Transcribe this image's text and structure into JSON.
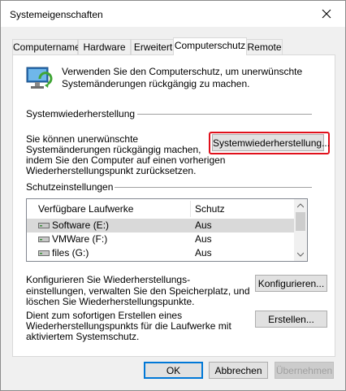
{
  "window": {
    "title": "Systemeigenschaften"
  },
  "tabs": [
    {
      "label": "Computername"
    },
    {
      "label": "Hardware"
    },
    {
      "label": "Erweitert"
    },
    {
      "label": "Computerschutz"
    },
    {
      "label": "Remote"
    }
  ],
  "intro": {
    "line1": "Verwenden Sie den Computerschutz, um unerwünschte",
    "line2": "Systemänderungen rückgängig zu machen."
  },
  "restore": {
    "heading": "Systemwiederherstellung",
    "line1": "Sie können unerwünschte",
    "line2": "Systemänderungen rückgängig machen,",
    "line3": "indem Sie den Computer auf einen vorherigen",
    "line4": "Wiederherstellungspunkt zurücksetzen.",
    "button": "Systemwiederherstellung..."
  },
  "protection": {
    "heading": "Schutzeinstellungen",
    "columns": {
      "drives": "Verfügbare Laufwerke",
      "protection": "Schutz"
    },
    "rows": [
      {
        "drive": "Software (E:)",
        "status": "Aus",
        "icon": "drive-icon"
      },
      {
        "drive": "VMWare (F:)",
        "status": "Aus",
        "icon": "drive-icon"
      },
      {
        "drive": "files (G:)",
        "status": "Aus",
        "icon": "drive-icon"
      }
    ],
    "configure": {
      "line1": "Konfigurieren Sie Wiederherstellungs-",
      "line2": "einstellungen, verwalten Sie den Speicherplatz, und",
      "line3": "löschen Sie Wiederherstellungspunkte.",
      "button": "Konfigurieren..."
    },
    "create": {
      "line1": "Dient zum sofortigen Erstellen eines",
      "line2": "Wiederherstellungspunkts für die Laufwerke mit",
      "line3": "aktiviertem Systemschutz.",
      "button": "Erstellen..."
    }
  },
  "footer": {
    "ok": "OK",
    "cancel": "Abbrechen",
    "apply": "Übernehmen"
  },
  "colors": {
    "highlight": "#e0101b",
    "focus": "#0078d7"
  }
}
